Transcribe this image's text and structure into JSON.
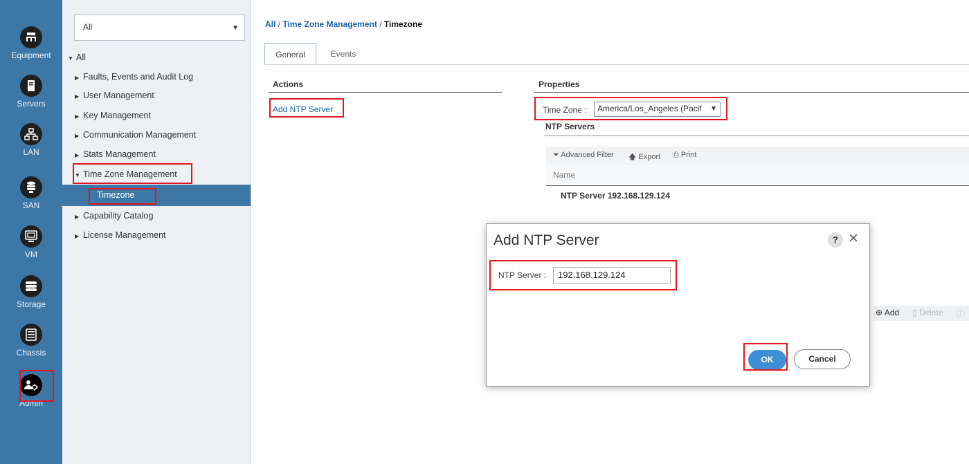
{
  "rail": {
    "items": [
      {
        "label": "Equipment",
        "icon": "equipment-icon"
      },
      {
        "label": "Servers",
        "icon": "servers-icon"
      },
      {
        "label": "LAN",
        "icon": "lan-icon"
      },
      {
        "label": "SAN",
        "icon": "san-icon"
      },
      {
        "label": "VM",
        "icon": "vm-icon"
      },
      {
        "label": "Storage",
        "icon": "storage-icon"
      },
      {
        "label": "Chassis",
        "icon": "chassis-icon"
      },
      {
        "label": "Admin",
        "icon": "admin-icon"
      }
    ]
  },
  "tree": {
    "filter_value": "All",
    "root": "All",
    "items": [
      "Faults, Events and Audit Log",
      "User Management",
      "Key Management",
      "Communication Management",
      "Stats Management",
      "Time Zone Management",
      "Timezone",
      "Capability Catalog",
      "License Management"
    ]
  },
  "breadcrumb": {
    "part1": "All",
    "sep": "/",
    "part2": "Time Zone Management",
    "part3": "Timezone"
  },
  "tabs": {
    "general": "General",
    "events": "Events"
  },
  "actions": {
    "heading": "Actions",
    "add_ntp": "Add NTP Server"
  },
  "properties": {
    "heading": "Properties",
    "tz_label": "Time Zone :",
    "tz_value": "America/Los_Angeles (Pacif",
    "ntp_heading": "NTP Servers",
    "toolbar": {
      "filter": "Advanced Filter",
      "export": "Export",
      "print": "Print"
    },
    "col_name": "Name",
    "rows": [
      "NTP Server 192.168.129.124"
    ],
    "add": "Add",
    "delete": "Delete"
  },
  "dialog": {
    "title": "Add NTP Server",
    "help": "?",
    "close": "×",
    "field_label": "NTP Server :",
    "field_value": "192.168.129.124",
    "ok": "OK",
    "cancel": "Cancel"
  },
  "colors": {
    "accent": "#3d77a6",
    "highlight": "#e0171f",
    "ok_button": "#3d8fd6"
  }
}
